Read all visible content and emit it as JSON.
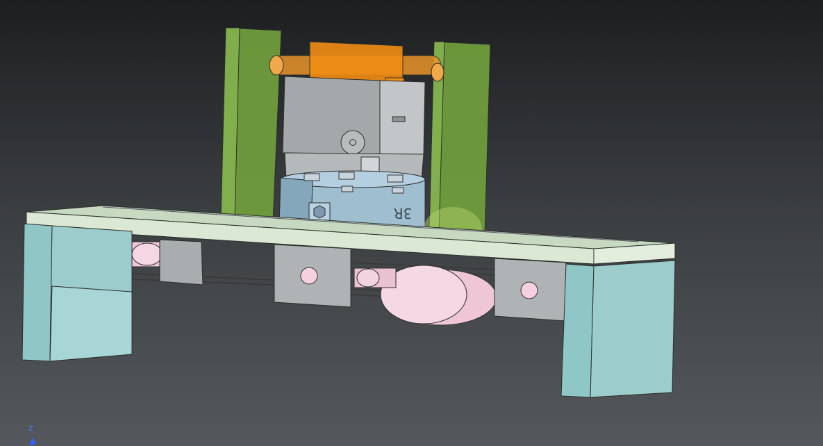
{
  "viewport": {
    "background_top": "#1c1e20",
    "background_bottom": "#54585c"
  },
  "part_colors": {
    "base_plate": "#d9e8d2",
    "end_blocks": "#9ccccc",
    "green_uprights": "#7fb04a",
    "orange_clamp": "#f08c14",
    "gray_housing": "#a9adb0",
    "chuck_ring": "#95b3c6",
    "pink_pulleys": "#f2cfe0"
  },
  "model": {
    "emboss_text": "3R"
  },
  "axis_triad": {
    "label": "Z",
    "color": "#2f63ff"
  }
}
